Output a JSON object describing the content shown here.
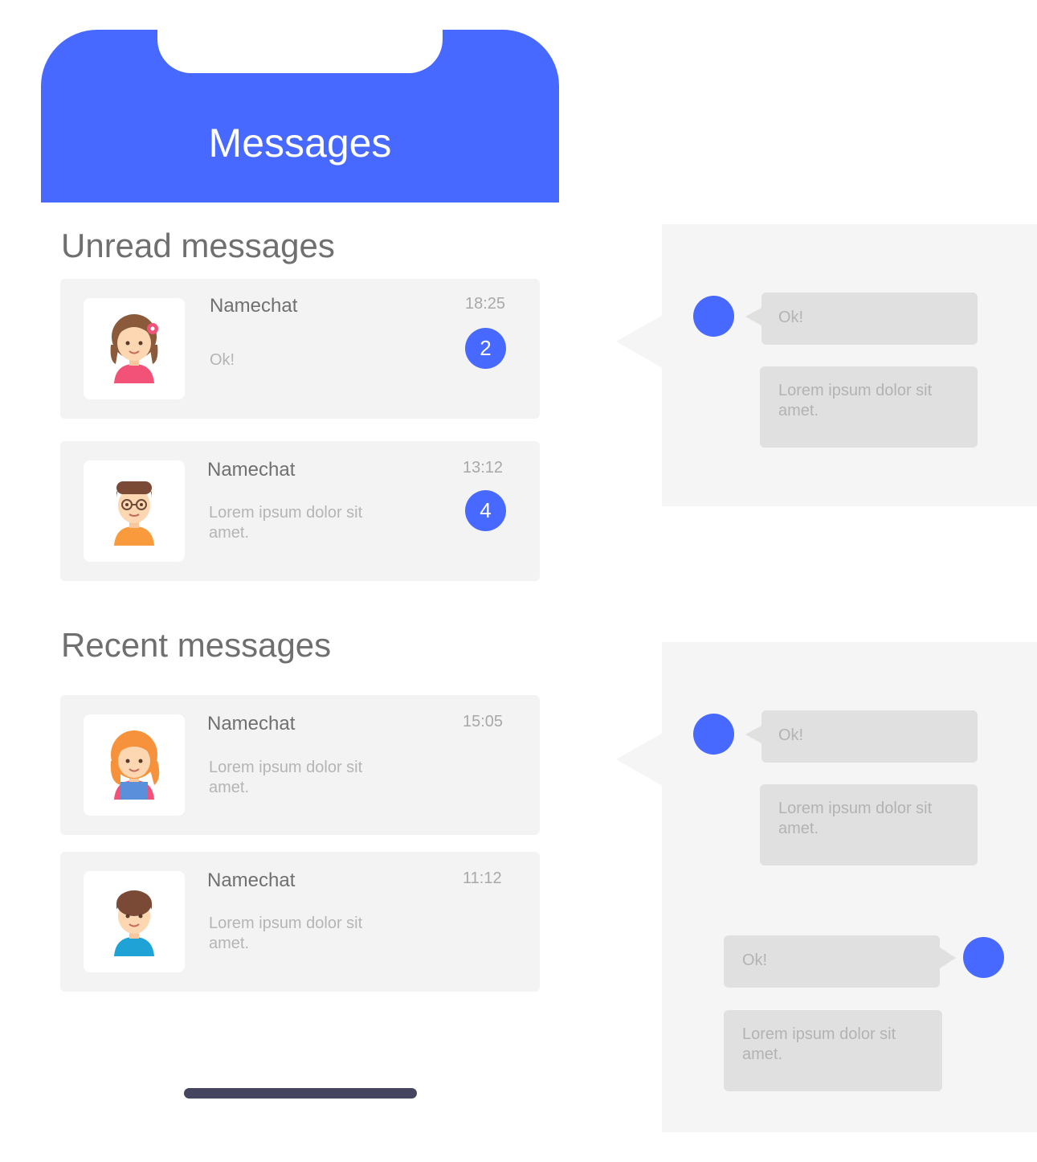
{
  "header": {
    "title": "Messages"
  },
  "unread": {
    "title": "Unread messages",
    "items": [
      {
        "name": "Namechat",
        "time": "18:25",
        "message": "Ok!",
        "badge": "2",
        "avatar": "girl-flower-avatar"
      },
      {
        "name": "Namechat",
        "time": "13:12",
        "message": "Lorem ipsum dolor sit amet.",
        "badge": "4",
        "avatar": "boy-glasses-avatar"
      }
    ]
  },
  "recent": {
    "title": "Recent messages",
    "items": [
      {
        "name": "Namechat",
        "time": "15:05",
        "message": "Lorem ipsum dolor sit amet.",
        "avatar": "girl-redhead-avatar"
      },
      {
        "name": "Namechat",
        "time": "11:12",
        "message": "Lorem ipsum dolor sit amet.",
        "avatar": "boy-brown-hair-avatar"
      }
    ]
  },
  "chat_previews": [
    {
      "messages": [
        "Ok!",
        "Lorem ipsum dolor sit amet."
      ]
    },
    {
      "messages": [
        "Ok!",
        "Lorem ipsum dolor sit amet.",
        "Ok!",
        "Lorem ipsum dolor sit amet."
      ]
    }
  ],
  "colors": {
    "accent": "#4869ff",
    "card": "#f3f3f3",
    "bubble": "#e0e0e0",
    "home_bar": "#454560"
  }
}
